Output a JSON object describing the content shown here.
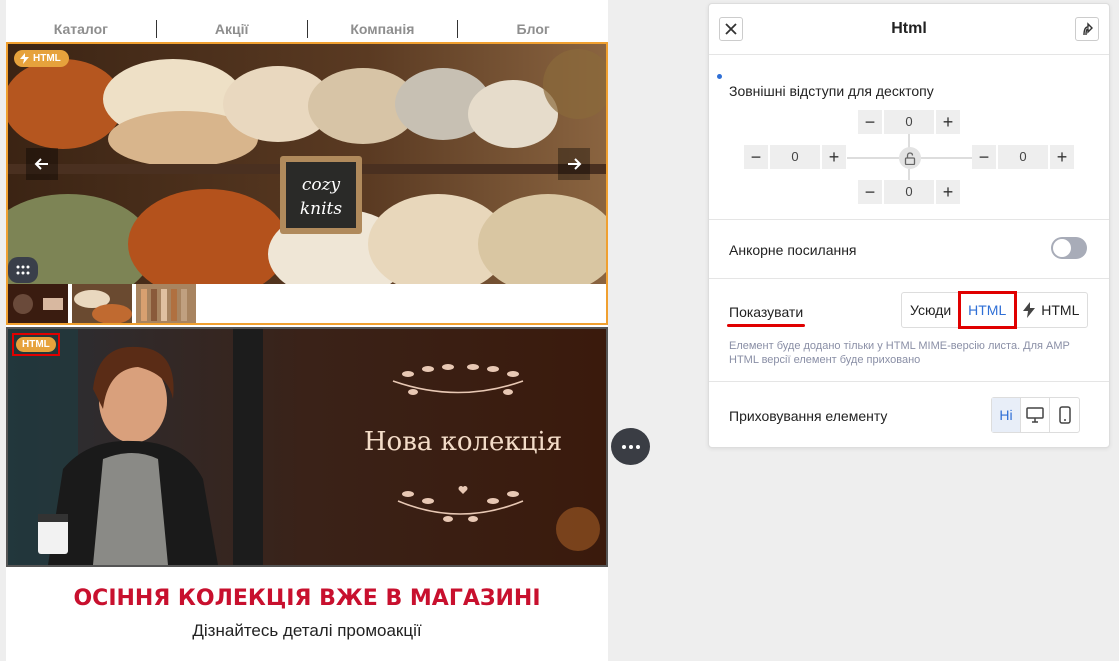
{
  "email": {
    "nav": [
      "Каталог",
      "Акції",
      "Компанія",
      "Блог"
    ],
    "slider": {
      "badge": "HTML",
      "sign_text": [
        "cozy",
        "knits"
      ]
    },
    "banner": {
      "badge": "HTML",
      "title": "Нова колекція"
    },
    "headline": "ОСІННЯ КОЛЕКЦІЯ ВЖЕ В МАГАЗИНІ",
    "subline": "Дізнайтесь деталі промоакції"
  },
  "panel": {
    "title": "Html",
    "margins": {
      "label": "Зовнішні відступи для десктопу",
      "top": "0",
      "left": "0",
      "right": "0",
      "bottom": "0"
    },
    "anchor": {
      "label": "Анкорне посилання",
      "enabled": false
    },
    "show": {
      "label": "Показувати",
      "options": [
        "Усюди",
        "HTML",
        "HTML"
      ],
      "selected": "HTML",
      "hint": "Елемент буде додано тільки у HTML MIME-версію листа. Для AMP HTML версії елемент буде приховано"
    },
    "hide": {
      "label": "Приховування елементу",
      "no_label": "Ні",
      "icons": [
        "desktop-icon",
        "mobile-icon"
      ]
    }
  },
  "colors": {
    "accent": "#2f6fd6",
    "headline": "#c8102e",
    "amp_badge": "#e6a23c",
    "highlight": "#e00000"
  }
}
